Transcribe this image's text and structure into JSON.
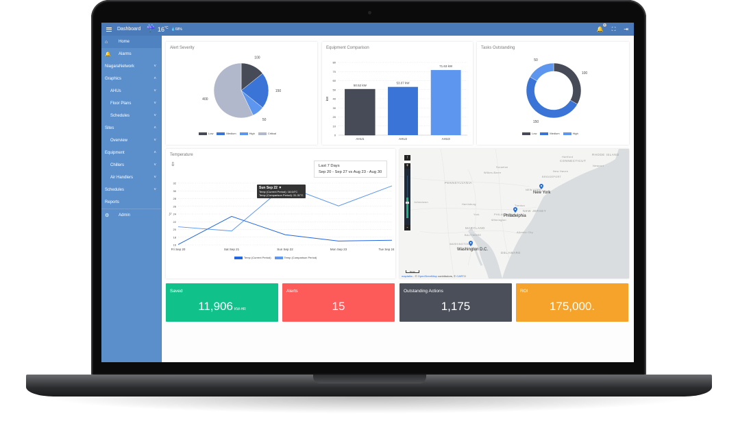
{
  "topbar": {
    "title": "Dashboard",
    "weather_icon": "rain-cloud-icon",
    "temperature": "16",
    "temperature_unit": "°C",
    "humidity": "68%",
    "notification_count": "1",
    "colors": {
      "topbar": "#4a7ab8",
      "sidebar": "#5b8fcc"
    }
  },
  "sidebar": {
    "items": [
      {
        "label": "Home",
        "icon": "home-icon",
        "chevron": "",
        "active": true
      },
      {
        "label": "Alarms",
        "icon": "bell-icon",
        "chevron": ""
      },
      {
        "label": "NiagaraNetwork",
        "chevron": "˅"
      },
      {
        "label": "Graphics",
        "chevron": "˄"
      },
      {
        "label": "AHUs",
        "chevron": "˅",
        "sub": true
      },
      {
        "label": "Floor Plans",
        "chevron": "˅",
        "sub": true
      },
      {
        "label": "Schedules",
        "chevron": "˅",
        "sub": true
      },
      {
        "label": "Sites",
        "chevron": "˄"
      },
      {
        "label": "Overview",
        "chevron": "˅",
        "sub": true
      },
      {
        "label": "Equipment",
        "chevron": "˄"
      },
      {
        "label": "Chillers",
        "chevron": "˅",
        "sub": true
      },
      {
        "label": "Air Handlers",
        "chevron": "˅",
        "sub": true
      },
      {
        "label": "Schedules",
        "chevron": "˅"
      },
      {
        "label": "Reports",
        "chevron": ""
      },
      {
        "label": "Admin",
        "icon": "gear-icon",
        "chevron": ""
      }
    ]
  },
  "alert_severity": {
    "title": "Alert Severity"
  },
  "equipment_comparison": {
    "title": "Equipment Comparison"
  },
  "tasks_outstanding": {
    "title": "Tasks Outstanding"
  },
  "temperature": {
    "title": "Temperature",
    "download_icon": "download-icon",
    "range_label": "Last 7 Days",
    "range_detail": "Sep 20 - Sep 27 vs Aug 23 - Aug 30",
    "tooltip": {
      "title": "Sun Sep 22 ▼",
      "line1": "Temp (Current Period): 18.64°C",
      "line2": "Temp (Comparison Period): 31.31°C"
    }
  },
  "map": {
    "markers": [
      {
        "label": "New York"
      },
      {
        "label": "Philadelphia"
      },
      {
        "label": "Washington D.C."
      }
    ],
    "states": [
      "PENNSYLVANIA",
      "NEW JERSEY",
      "MARYLAND",
      "DELAWARE",
      "CONNECTICUT",
      "RHODE ISLAND"
    ],
    "cities": [
      "Scranton",
      "Wilkes-Barre",
      "Hartford",
      "New Haven",
      "BRIDGEPORT",
      "NEW YORK",
      "Newport",
      "Johnstown",
      "Harrisburg",
      "Trenton",
      "PHILADELPHIA",
      "York",
      "Wilmington",
      "BALTIMORE",
      "Atlantic City",
      "WASHINGTON"
    ],
    "zoom_in": "+",
    "zoom_out": "-",
    "compass": "↑",
    "scale": "50 km",
    "attribution_a": "maptalks",
    "attribution_b": " - © ",
    "attribution_c": "OpenStreetMap",
    "attribution_d": " contributors, © ",
    "attribution_e": "CARTO",
    "zoom_level_fraction": 0.45
  },
  "stats": [
    {
      "label": "Saved",
      "value": "11,906",
      "unit": "KW-HR",
      "color": "#11c18a"
    },
    {
      "label": "Alerts",
      "value": "15",
      "unit": "",
      "color": "#fd5a5a"
    },
    {
      "label": "Outstanding Actions",
      "value": "1,175",
      "unit": "",
      "color": "#4a4f5a"
    },
    {
      "label": "ROI",
      "value": "175,000.",
      "unit": "",
      "color": "#f5a32a"
    }
  ],
  "chart_data": [
    {
      "type": "pie",
      "title": "Alert Severity",
      "categories": [
        "Low",
        "Medium",
        "High",
        "Critical"
      ],
      "values": [
        100,
        150,
        50,
        400
      ],
      "colors": [
        "#474b57",
        "#3a74d6",
        "#5c96ef",
        "#b2b8cc"
      ],
      "legend": "bottom"
    },
    {
      "type": "bar",
      "title": "Equipment Comparison",
      "categories": [
        "AHU1",
        "AHU2",
        "AHU3"
      ],
      "values": [
        50.52,
        53.07,
        71.63
      ],
      "data_labels": [
        "50.52 kW",
        "53.07 kW",
        "71.63 kW"
      ],
      "colors": [
        "#474b57",
        "#3a74d6",
        "#5c96ef"
      ],
      "xlabel": "",
      "ylabel": "kW",
      "ylim": [
        0,
        80
      ],
      "yticks": [
        0,
        10,
        20,
        30,
        40,
        50,
        60,
        70,
        80
      ],
      "grid": true
    },
    {
      "type": "pie",
      "subtype": "donut",
      "title": "Tasks Outstanding",
      "categories": [
        "Low",
        "Medium",
        "High"
      ],
      "values": [
        100,
        150,
        50
      ],
      "colors": [
        "#474b57",
        "#3a74d6",
        "#5c96ef"
      ],
      "legend": "bottom"
    },
    {
      "type": "line",
      "title": "Temperature",
      "x": [
        "Fri Sep 20",
        "Sat Sep 21",
        "Sun Sep 22",
        "Mon Sep 23",
        "Tue Sep 24"
      ],
      "series": [
        {
          "name": "Temp (Current Period)",
          "values": [
            16.1,
            23.4,
            18.64,
            17.0,
            17.2
          ],
          "color": "#2166e0"
        },
        {
          "name": "Temp (Comparison Period)",
          "values": [
            20.7,
            19.6,
            31.31,
            26.1,
            31.3
          ],
          "color": "#5c96ef"
        }
      ],
      "ylabel": "°C",
      "ylim": [
        16,
        32
      ],
      "yticks": [
        16,
        18,
        20,
        22,
        24,
        26,
        28,
        30,
        32
      ],
      "grid": true,
      "legend": "bottom"
    }
  ]
}
